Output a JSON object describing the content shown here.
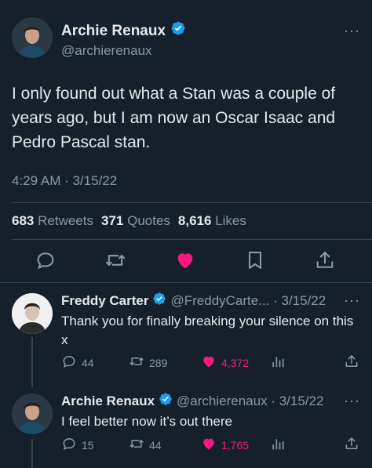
{
  "tweet": {
    "author_name": "Archie Renaux",
    "author_handle": "@archierenaux",
    "text": "I only found out what a Stan was a couple of years ago, but I am now an Oscar Isaac and Pedro Pascal stan.",
    "timestamp": "4:29 AM · 3/15/22",
    "retweets_count": "683",
    "retweets_label": "Retweets",
    "quotes_count": "371",
    "quotes_label": "Quotes",
    "likes_count": "8,616",
    "likes_label": "Likes"
  },
  "replies": [
    {
      "author_name": "Freddy Carter",
      "meta": "@FreddyCarte... · 3/15/22",
      "text": "Thank you for finally breaking your silence on this x",
      "replies": "44",
      "retweets": "289",
      "likes": "4,372"
    },
    {
      "author_name": "Archie Renaux",
      "meta": "@archierenaux · 3/15/22",
      "text": "I feel better now it’s out there",
      "replies": "15",
      "retweets": "44",
      "likes": "1,765"
    }
  ],
  "icons": {
    "more": "more-icon",
    "verified": "verified-badge-icon",
    "reply": "reply-icon",
    "retweet": "retweet-icon",
    "like": "heart-icon",
    "bookmark": "bookmark-icon",
    "share": "share-icon",
    "analytics": "analytics-icon"
  },
  "colors": {
    "background": "#15202b",
    "text": "#e7e9ea",
    "muted": "#8b98a5",
    "accent": "#1d9bf0",
    "like": "#f91880"
  }
}
